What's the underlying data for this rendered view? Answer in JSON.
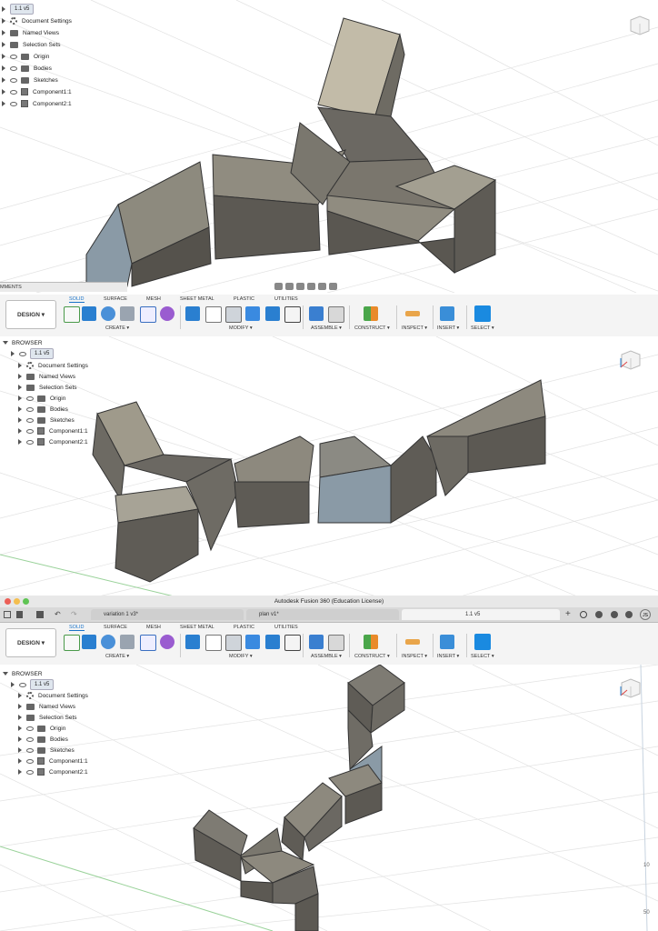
{
  "app_title": "Autodesk Fusion 360 (Education License)",
  "design_label": "DESIGN ▾",
  "browser_label": "BROWSER",
  "comments_label": "MMENTS",
  "version_badge": "1.1 v5",
  "browser_items": [
    "Document Settings",
    "Named Views",
    "Selection Sets",
    "Origin",
    "Bodies",
    "Sketches",
    "Component1:1",
    "Component2:1"
  ],
  "tabs": [
    "SOLID",
    "SURFACE",
    "MESH",
    "SHEET METAL",
    "PLASTIC",
    "UTILITIES"
  ],
  "groups": [
    "CREATE ▾",
    "MODIFY ▾",
    "ASSEMBLE ▾",
    "CONSTRUCT ▾",
    "INSPECT ▾",
    "INSERT ▾",
    "SELECT ▾"
  ],
  "doc_tabs": [
    "variation 1 v3*",
    "plan v1*",
    "1.1 v5"
  ],
  "user_initials": "JS",
  "axis_labels": [
    "10",
    "50"
  ],
  "colors": {
    "accent": "#1a73c8",
    "solid_face_light": "#a9a596",
    "solid_face_mid": "#7d7a70",
    "solid_face_dark": "#55524c",
    "bluegray": "#8a9aa6"
  }
}
